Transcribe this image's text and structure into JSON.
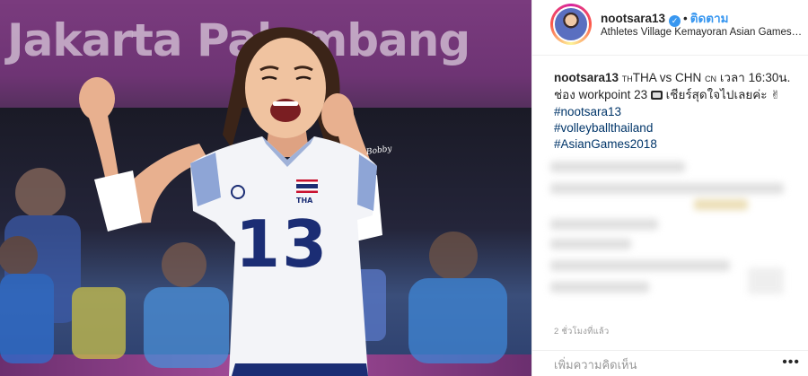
{
  "photo": {
    "banner_text": "Jakarta Palembang",
    "jersey_number": "13",
    "jersey_country": "THA",
    "watermark": "Bobby"
  },
  "header": {
    "username": "nootsara13",
    "verified_icon": "verified-check-icon",
    "separator": "•",
    "follow_label": "ติดตาม",
    "location": "Athletes Village Kemayoran Asian Games ..."
  },
  "caption": {
    "username": "nootsara13",
    "line1_a": "TH",
    "line1_b": "THA vs CHN ",
    "line1_c": "CN",
    "line1_d": " เวลา 16:30น.",
    "line2_a": "ช่อง workpoint 23 ",
    "line2_b": " เชียร์สุดใจไปเลยค่ะ ",
    "hand_glyph": "✌",
    "hashtags": [
      "#nootsara13",
      "#volleyballthailand",
      "#AsianGames2018"
    ]
  },
  "timestamp": "2 ชั่วโมงที่แล้ว",
  "comment": {
    "placeholder": "เพิ่มความคิดเห็น",
    "more_glyph": "•••"
  },
  "colors": {
    "link_blue": "#3897f0",
    "hashtag_blue": "#003569",
    "banner_purple": "#6e3474"
  }
}
